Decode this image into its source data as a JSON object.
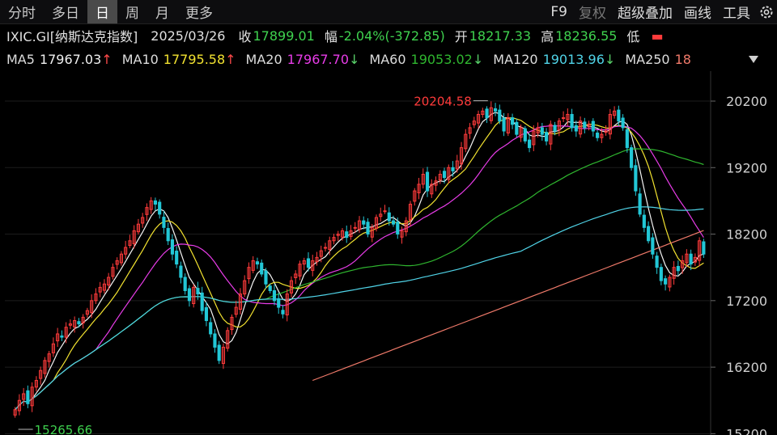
{
  "toolbar": {
    "tabs": [
      "分时",
      "多日",
      "日",
      "周",
      "月",
      "更多"
    ],
    "active_tab": "日",
    "tools": [
      "F9",
      "复权",
      "超级叠加",
      "画线",
      "工具"
    ],
    "gear_icon": "gear-icon"
  },
  "info": {
    "symbol": "IXIC.GI[纳斯达克指数]",
    "date": "2025/03/26",
    "close_label": "收",
    "close": "17899.01",
    "change_label": "幅",
    "change": "-2.04%(-372.85)",
    "open_label": "开",
    "open": "18217.33",
    "high_label": "高",
    "high": "18236.55",
    "low_label": "低"
  },
  "ma": {
    "ma5_label": "MA5",
    "ma5": "17967.03",
    "ma5_arrow": "↑",
    "ma10_label": "MA10",
    "ma10": "17795.58",
    "ma10_arrow": "↑",
    "ma20_label": "MA20",
    "ma20": "17967.70",
    "ma20_arrow": "↓",
    "ma60_label": "MA60",
    "ma60": "19053.02",
    "ma60_arrow": "↓",
    "ma120_label": "MA120",
    "ma120": "19013.96",
    "ma120_arrow": "↓",
    "ma250_label": "MA250",
    "ma250": "18"
  },
  "colors": {
    "up": "#ff3b3b",
    "down": "#22c7d6",
    "ma5": "#f5f5f5",
    "ma10": "#f2e230",
    "ma20": "#e83ce8",
    "ma60": "#2fb62f",
    "ma120": "#50d4e8",
    "ma250": "#f07a6a",
    "high_marker": "#ff3b3b",
    "low_marker": "#3fd24f"
  },
  "chart_data": {
    "type": "candlestick",
    "y_ticks": [
      20200,
      19200,
      18200,
      17200,
      16200,
      15200
    ],
    "ylim": [
      15180,
      20650
    ],
    "high_marker": {
      "value": 20204.58,
      "label": "20204.58"
    },
    "low_marker": {
      "value": 15265.66,
      "label": "15265.66"
    },
    "closes": [
      15560,
      15700,
      15800,
      15650,
      15900,
      16000,
      16150,
      16300,
      16400,
      16550,
      16700,
      16650,
      16800,
      16850,
      16900,
      16850,
      16950,
      17050,
      17200,
      17300,
      17400,
      17450,
      17550,
      17700,
      17800,
      17900,
      18000,
      18100,
      18250,
      18350,
      18450,
      18600,
      18700,
      18650,
      18500,
      18300,
      18100,
      17900,
      17750,
      17550,
      17350,
      17200,
      17400,
      17300,
      17050,
      16900,
      16700,
      16500,
      16300,
      16500,
      16750,
      16950,
      17100,
      17300,
      17500,
      17700,
      17800,
      17750,
      17600,
      17450,
      17350,
      17200,
      17100,
      17000,
      17300,
      17500,
      17600,
      17750,
      17800,
      17700,
      17800,
      17850,
      17950,
      18000,
      18100,
      18150,
      18200,
      18250,
      18150,
      18250,
      18300,
      18400,
      18350,
      18200,
      18300,
      18450,
      18500,
      18550,
      18400,
      18350,
      18200,
      18250,
      18400,
      18650,
      18850,
      18950,
      19100,
      18850,
      18950,
      19000,
      19100,
      19050,
      19200,
      19150,
      19300,
      19500,
      19700,
      19800,
      19900,
      20000,
      20050,
      19950,
      20100,
      20050,
      19900,
      19750,
      19950,
      19850,
      19700,
      19800,
      19600,
      19500,
      19750,
      19800,
      19700,
      19600,
      19850,
      19750,
      19900,
      19950,
      20000,
      19800,
      19750,
      19900,
      19800,
      19850,
      19750,
      19650,
      19700,
      19750,
      20000,
      20050,
      19900,
      19800,
      19500,
      19200,
      18850,
      18500,
      18300,
      18100,
      17900,
      17700,
      17500,
      17450,
      17550,
      17700,
      17650,
      17800,
      17900,
      17750,
      17850,
      18100,
      17900
    ]
  }
}
